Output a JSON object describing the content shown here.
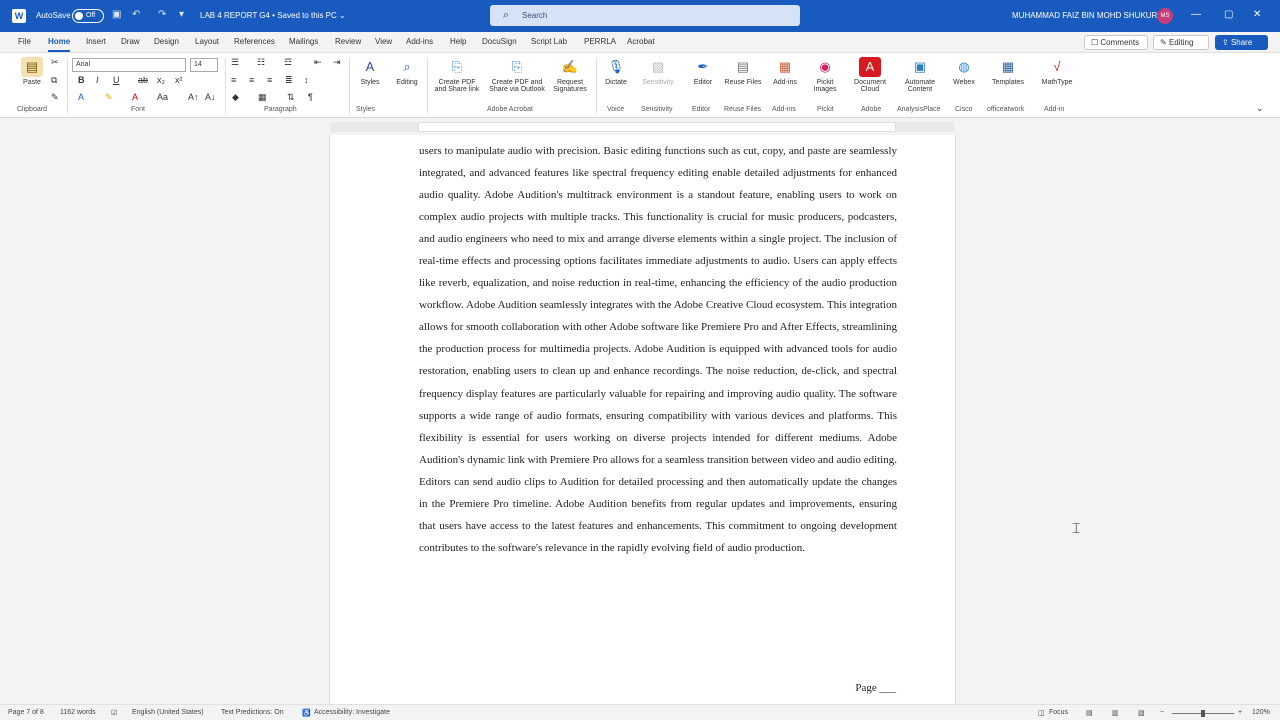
{
  "titlebar": {
    "autosave_label": "AutoSave",
    "autosave_state": "Off",
    "doc_title": "LAB 4 REPORT G4 • Saved to this PC ⌄",
    "search_placeholder": "Search",
    "user_name": "MUHAMMAD FAIZ BIN MOHD SHUKUR",
    "avatar_initials": "MS",
    "icons": [
      "word-icon",
      "save-icon",
      "undo-icon",
      "redo-icon",
      "customize-icon",
      "minimize-icon",
      "restore-icon",
      "close-icon"
    ]
  },
  "menu": {
    "tabs": [
      "File",
      "Home",
      "Insert",
      "Draw",
      "Design",
      "Layout",
      "References",
      "Mailings",
      "Review",
      "View",
      "Add-ins",
      "Help",
      "DocuSign",
      "Script Lab",
      "PERRLA",
      "Acrobat"
    ],
    "active_tab": "Home",
    "comments_label": "Comments",
    "editing_label": "Editing",
    "share_label": "Share"
  },
  "ribbon": {
    "paste_label": "Paste",
    "font_name": "Arial",
    "font_size": "14",
    "group_labels": [
      "Clipboard",
      "Font",
      "Paragraph",
      "Styles",
      "Adobe Acrobat",
      "Voice",
      "Sensitivity",
      "Editor",
      "Reuse Files",
      "Add-ins",
      "Pickit",
      "Adobe",
      "AnalysisPlace",
      "Cisco",
      "officeatwork",
      "Add-in"
    ],
    "buttons": [
      "Styles",
      "Editing",
      "Create PDF and Share link",
      "Create PDF and Share via Outlook",
      "Request Signatures",
      "Dictate",
      "Sensitivity",
      "Editor",
      "Reuse Files",
      "Add-ins",
      "Pickit Images",
      "Document Cloud",
      "Automate Content",
      "Webex",
      "Templates",
      "MathType"
    ]
  },
  "document": {
    "paragraph": "users to manipulate audio with precision. Basic editing functions such as cut, copy, and paste are seamlessly integrated, and advanced features like spectral frequency editing enable detailed adjustments for enhanced audio quality. Adobe Audition's multitrack environment is a standout feature, enabling users to work on complex audio projects with multiple tracks. This functionality is crucial for music producers, podcasters, and audio engineers who need to mix and arrange diverse elements within a single project. The inclusion of real-time effects and processing options facilitates immediate adjustments to audio. Users can apply effects like reverb, equalization, and noise reduction in real-time, enhancing the efficiency of the audio production workflow. Adobe Audition seamlessly integrates with the Adobe Creative Cloud ecosystem. This integration allows for smooth collaboration with other Adobe software like Premiere Pro and After Effects, streamlining the production process for multimedia projects. Adobe Audition is equipped with advanced tools for audio restoration, enabling users to clean up and enhance recordings. The noise reduction, de-click, and spectral frequency display features are particularly valuable for repairing and improving audio quality. The software supports a wide range of audio formats, ensuring compatibility with various devices and platforms. This flexibility is essential for users working on diverse projects intended for different mediums. Adobe Audition's dynamic link with Premiere Pro allows for a seamless transition between video and audio editing. Editors can send audio clips to Audition for detailed processing and then automatically update the changes in the Premiere Pro timeline. Adobe Audition benefits from regular updates and improvements, ensuring that users have access to the latest features and enhancements. This commitment to ongoing development contributes to the software's relevance in the rapidly evolving field of audio production.",
    "page_footer": "Page ___"
  },
  "status": {
    "page": "Page 7 of 8",
    "words": "1162 words",
    "language": "English (United States)",
    "text_predictions": "Text Predictions: On",
    "accessibility": "Accessibility: Investigate",
    "focus": "Focus",
    "zoom": "120%"
  }
}
